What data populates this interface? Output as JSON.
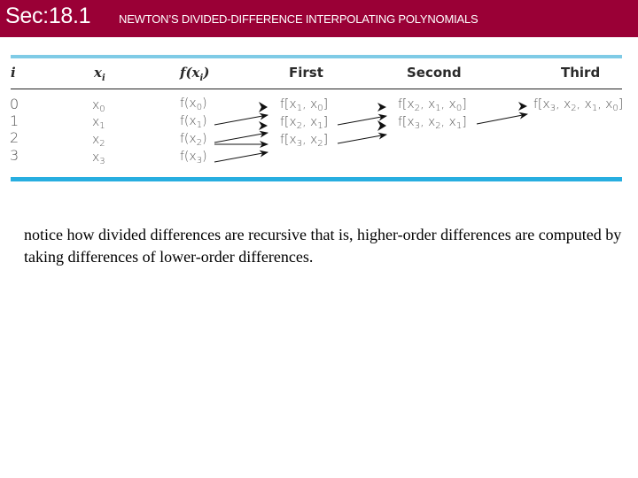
{
  "header": {
    "section": "Sec:18.1",
    "title": "NEWTON’S DIVIDED-DIFFERENCE INTERPOLATING  POLYNOMIALS",
    "background_color": "#9a0036"
  },
  "table": {
    "columns": [
      "i",
      "xi",
      "f(xi)",
      "First",
      "Second",
      "Third"
    ],
    "rows": [
      {
        "i": "0",
        "x": "x0",
        "fx": "f(x0)",
        "first": "f[x1, x0]",
        "second": "f[x2, x1, x0]",
        "third": "f[x3, x2, x1, x0]"
      },
      {
        "i": "1",
        "x": "x1",
        "fx": "f(x1)",
        "first": "f[x2, x1]",
        "second": "f[x3, x2, x1]",
        "third": ""
      },
      {
        "i": "2",
        "x": "x2",
        "fx": "f(x2)",
        "first": "f[x3, x2]",
        "second": "",
        "third": ""
      },
      {
        "i": "3",
        "x": "x3",
        "fx": "f(x3)",
        "first": "",
        "second": "",
        "third": ""
      }
    ],
    "accent_color": "#27aee0"
  },
  "note": "notice how divided differences are recursive that is, higher-order differences are computed by taking differences of lower-order differences."
}
